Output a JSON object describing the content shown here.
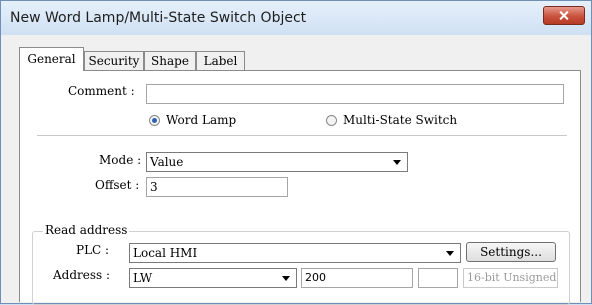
{
  "window": {
    "title": "New Word Lamp/Multi-State Switch Object"
  },
  "tabs": [
    "General",
    "Security",
    "Shape",
    "Label"
  ],
  "general": {
    "comment_label": "Comment :",
    "comment_value": "",
    "radio_word_lamp": "Word Lamp",
    "radio_multi_state": "Multi-State Switch",
    "selected_radio": "Word Lamp",
    "mode_label": "Mode :",
    "mode_value": "Value",
    "offset_label": "Offset :",
    "offset_value": "3"
  },
  "read_address": {
    "legend": "Read address",
    "plc_label": "PLC :",
    "plc_value": "Local HMI",
    "settings_button": "Settings...",
    "address_label": "Address :",
    "address_device": "LW",
    "address_value": "200",
    "address_index": "",
    "data_format": "16-bit Unsigned"
  },
  "colors": {
    "title_bar": "#cfe0f3",
    "close_button": "#c9513e",
    "radio_selected": "#2d62b8"
  },
  "icons": {
    "close": "close-icon",
    "dropdown": "chevron-down-icon"
  }
}
